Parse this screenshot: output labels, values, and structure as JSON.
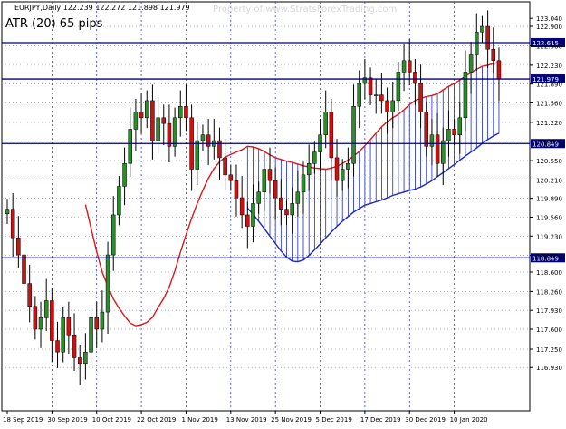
{
  "header": {
    "symbol_line": "EURJPY,Daily  122.239 122.272 121.898 121.979",
    "watermark": "Property of www.StratsForexTrading.com",
    "annotation": "ATR (20) 65 pips"
  },
  "colors": {
    "bull": "#2e8b2e",
    "bear": "#d01010",
    "ma_fast": "#e01515",
    "ma_slow": "#1a28c8",
    "fill_bull": "#1a28c8",
    "fill_bear": "#e01515",
    "level": "#00007a",
    "grid": "#8a8ab0"
  },
  "chart_data": {
    "type": "candlestick",
    "instrument": "EURJPY",
    "timeframe": "Daily",
    "ylim": [
      116.6,
      123.17
    ],
    "yticks": [
      116.93,
      117.25,
      117.6,
      117.93,
      118.26,
      118.6,
      118.89,
      119.23,
      119.56,
      119.89,
      120.21,
      120.55,
      120.89,
      121.22,
      121.56,
      121.89,
      122.22,
      122.56,
      122.9,
      123.04
    ],
    "ytick_labels": [
      "116.930",
      "117.250",
      "117.600",
      "117.930",
      "118.260",
      "118.600",
      "118.890",
      "119.230",
      "119.560",
      "119.890",
      "120.210",
      "120.550",
      "120.890",
      "121.220",
      "121.560",
      "121.890",
      "122.230",
      "122.560",
      "122.900",
      "123.040"
    ],
    "xtick_labels": [
      {
        "label": "18 Sep 2019",
        "index": 0
      },
      {
        "label": "30 Sep 2019",
        "index": 8
      },
      {
        "label": "10 Oct 2019",
        "index": 16
      },
      {
        "label": "22 Oct 2019",
        "index": 24
      },
      {
        "label": "1 Nov 2019",
        "index": 32
      },
      {
        "label": "13 Nov 2019",
        "index": 40
      },
      {
        "label": "25 Nov 2019",
        "index": 48
      },
      {
        "label": "5 Dec 2019",
        "index": 56
      },
      {
        "label": "17 Dec 2019",
        "index": 64
      },
      {
        "label": "30 Dec 2019",
        "index": 72
      },
      {
        "label": "10 Jan 2020",
        "index": 80
      }
    ],
    "levels": [
      {
        "value": 122.615,
        "label": "122.615"
      },
      {
        "value": 121.979,
        "label": "121.979"
      },
      {
        "value": 120.849,
        "label": "120.849"
      },
      {
        "value": 118.849,
        "label": "118.849"
      }
    ],
    "closes": [
      119.7,
      119.2,
      118.9,
      118.4,
      118.0,
      117.6,
      117.8,
      118.1,
      117.4,
      117.2,
      117.8,
      117.5,
      117.1,
      117.0,
      117.2,
      117.8,
      117.6,
      117.9,
      118.9,
      119.6,
      120.1,
      120.5,
      121.1,
      121.4,
      121.3,
      121.6,
      120.9,
      121.3,
      121.2,
      120.8,
      121.3,
      121.5,
      121.3,
      120.4,
      120.9,
      121.0,
      120.8,
      120.9,
      120.6,
      120.3,
      120.2,
      119.9,
      119.6,
      119.4,
      119.8,
      120.0,
      120.4,
      120.2,
      119.9,
      119.7,
      119.6,
      119.8,
      120.0,
      120.3,
      120.5,
      120.7,
      121.0,
      121.4,
      120.6,
      120.2,
      120.4,
      120.5,
      121.5,
      121.9,
      122.0,
      121.7,
      121.7,
      121.6,
      121.4,
      121.6,
      122.1,
      122.3,
      122.1,
      121.9,
      121.4,
      120.8,
      121.0,
      120.5,
      120.9,
      121.1,
      121.0,
      121.3,
      122.1,
      122.4,
      122.8,
      122.9,
      122.5,
      122.3,
      121.98
    ],
    "ma_fast": [
      119.78,
      119.37,
      118.96,
      118.6,
      118.35,
      118.13,
      117.97,
      117.83,
      117.71,
      117.66,
      117.68,
      117.72,
      117.81,
      117.98,
      118.14,
      118.34,
      118.62,
      118.95,
      119.25,
      119.54,
      119.8,
      120.03,
      120.24,
      120.41,
      120.53,
      120.61,
      120.66,
      120.7,
      120.74,
      120.8,
      120.79,
      120.76,
      120.71,
      120.65,
      120.6,
      120.57,
      120.54,
      120.52,
      120.49,
      120.46,
      120.44,
      120.42,
      120.41,
      120.4,
      120.42,
      120.45,
      120.5,
      120.56,
      120.63,
      120.71,
      120.81,
      120.92,
      121.03,
      121.14,
      121.23,
      121.3,
      121.36,
      121.44,
      121.53,
      121.6,
      121.64,
      121.67,
      121.69,
      121.72,
      121.79,
      121.85,
      121.9,
      121.96,
      122.03,
      122.09,
      122.15,
      122.2,
      122.22,
      122.25,
      122.27
    ],
    "ma_slow": [
      119.72,
      119.61,
      119.49,
      119.36,
      119.23,
      119.1,
      118.97,
      118.86,
      118.79,
      118.78,
      118.81,
      118.89,
      118.99,
      119.09,
      119.2,
      119.3,
      119.4,
      119.49,
      119.57,
      119.65,
      119.71,
      119.77,
      119.8,
      119.83,
      119.86,
      119.9,
      119.94,
      119.97,
      120.0,
      120.03,
      120.05,
      120.09,
      120.14,
      120.2,
      120.27,
      120.34,
      120.41,
      120.48,
      120.56,
      120.63,
      120.7,
      120.77,
      120.85,
      120.92,
      120.98,
      121.03
    ]
  }
}
